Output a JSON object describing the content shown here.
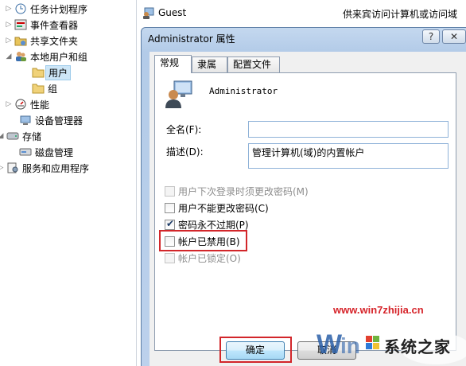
{
  "tree": {
    "items": [
      {
        "label": "任务计划程序",
        "icon": "clock-icon",
        "arrow": "▷"
      },
      {
        "label": "事件查看器",
        "icon": "event-viewer-icon",
        "arrow": "▷"
      },
      {
        "label": "共享文件夹",
        "icon": "shared-folder-icon",
        "arrow": "▷"
      },
      {
        "label": "本地用户和组",
        "icon": "users-icon",
        "arrow": "◢"
      },
      {
        "label": "用户",
        "icon": "folder-icon",
        "arrow": ""
      },
      {
        "label": "组",
        "icon": "folder-icon",
        "arrow": ""
      },
      {
        "label": "性能",
        "icon": "performance-icon",
        "arrow": "▷"
      },
      {
        "label": "设备管理器",
        "icon": "device-manager-icon",
        "arrow": ""
      },
      {
        "label": "存储",
        "icon": "storage-icon",
        "arrow": "◢"
      },
      {
        "label": "磁盘管理",
        "icon": "disk-icon",
        "arrow": ""
      },
      {
        "label": "服务和应用程序",
        "icon": "services-icon",
        "arrow": "▷"
      }
    ]
  },
  "list": {
    "guest_name": "Guest",
    "guest_desc": "供来宾访问计算机或访问域"
  },
  "dialog": {
    "title": "Administrator 属性",
    "help": "?",
    "close": "✕",
    "tabs": [
      "常规",
      "隶属于",
      "配置文件"
    ],
    "username": "Administrator",
    "fullname_label": "全名(F):",
    "fullname_value": "",
    "desc_label": "描述(D):",
    "desc_value": "管理计算机(域)的内置帐户",
    "checkboxes": [
      {
        "label": "用户下次登录时须更改密码(M)",
        "checked": false,
        "disabled": true
      },
      {
        "label": "用户不能更改密码(C)",
        "checked": false,
        "disabled": false
      },
      {
        "label": "密码永不过期(P)",
        "checked": true,
        "disabled": false
      },
      {
        "label": "帐户已禁用(B)",
        "checked": false,
        "disabled": false
      },
      {
        "label": "帐户已锁定(O)",
        "checked": false,
        "disabled": true
      }
    ],
    "ok": "确定",
    "cancel": "取消"
  },
  "watermark": {
    "url": "www.win7zhijia.cn",
    "brand": "系统之家"
  },
  "colors": {
    "highlight": "#d2262a",
    "selection": "#cde6f7"
  }
}
